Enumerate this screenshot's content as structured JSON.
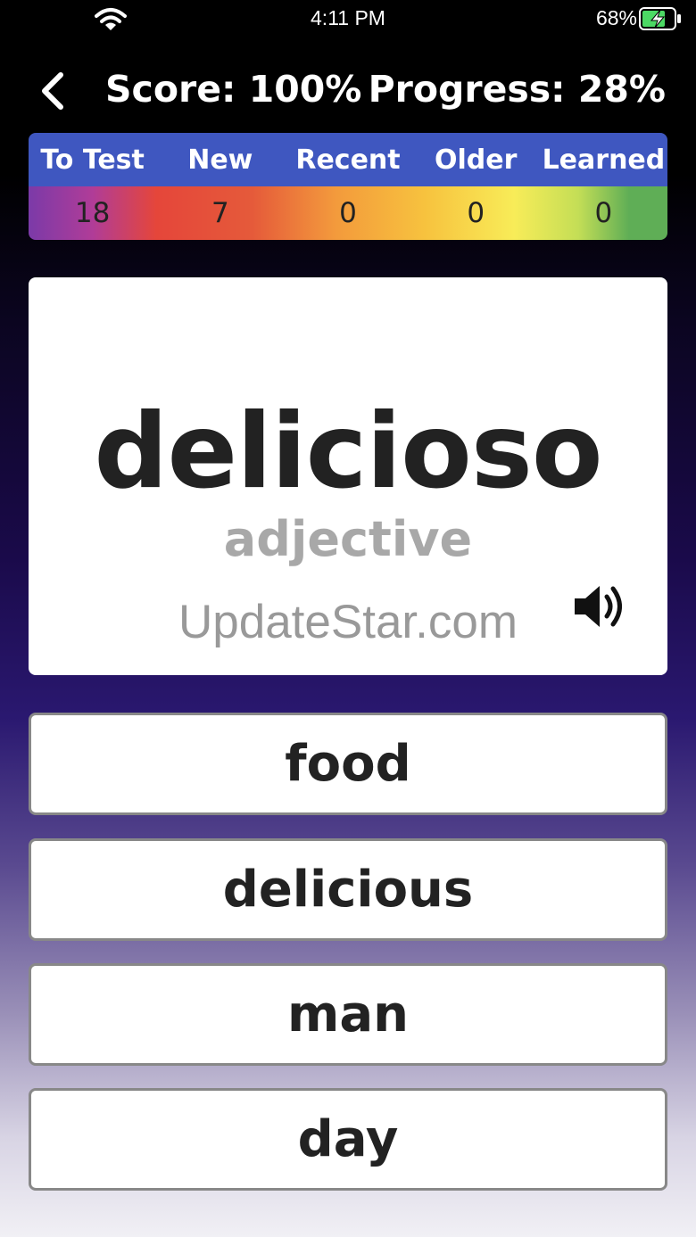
{
  "status_bar": {
    "time": "4:11 PM",
    "battery": "68%"
  },
  "header": {
    "score": "Score: 100%",
    "progress": "Progress: 28%"
  },
  "stats": {
    "headers": [
      "To Test",
      "New",
      "Recent",
      "Older",
      "Learned"
    ],
    "values": [
      "18",
      "7",
      "0",
      "0",
      "0"
    ]
  },
  "card": {
    "word": "delicioso",
    "part_of_speech": "adjective",
    "watermark": "UpdateStar.com"
  },
  "answers": [
    "food",
    "delicious",
    "man",
    "day"
  ],
  "colors": {
    "stats_header_bg": "#3f57c0",
    "battery_fill": "#4cd964"
  }
}
